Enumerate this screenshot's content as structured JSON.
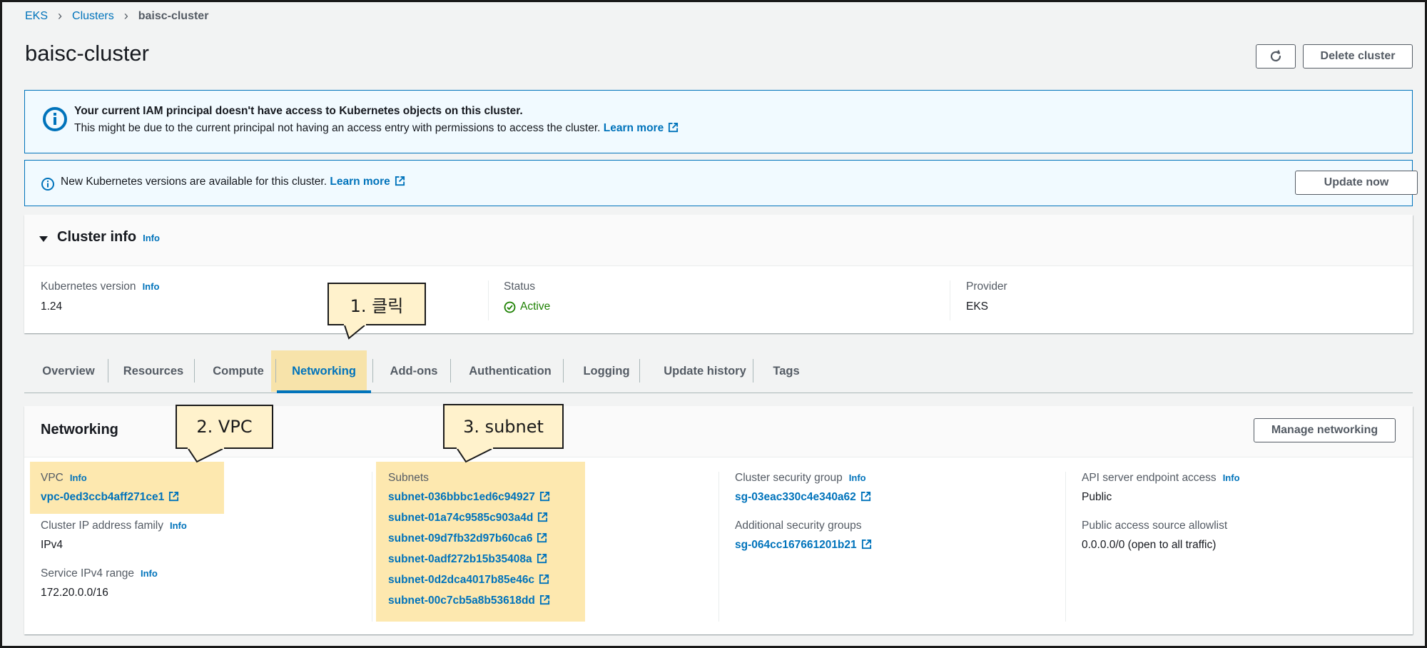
{
  "breadcrumb": {
    "items": [
      "EKS",
      "Clusters"
    ],
    "current": "baisc-cluster",
    "separator": ">"
  },
  "page": {
    "title": "baisc-cluster"
  },
  "header_buttons": {
    "refresh_icon": "refresh-icon",
    "delete_label": "Delete cluster"
  },
  "alerts": {
    "iam": {
      "title": "Your current IAM principal doesn't have access to Kubernetes objects on this cluster.",
      "body": "This might be due to the current principal not having an access entry with permissions to access the cluster.",
      "link": "Learn more"
    },
    "version": {
      "body": "New Kubernetes versions are available for this cluster.",
      "link": "Learn more",
      "button": "Update now"
    }
  },
  "cluster_info": {
    "title": "Cluster info",
    "info": "Info",
    "kubernetes_version": {
      "label": "Kubernetes version",
      "info": "Info",
      "value": "1.24"
    },
    "status": {
      "label": "Status",
      "value": "Active"
    },
    "provider": {
      "label": "Provider",
      "value": "EKS"
    }
  },
  "tabs": [
    "Overview",
    "Resources",
    "Compute",
    "Networking",
    "Add-ons",
    "Authentication",
    "Logging",
    "Update history",
    "Tags"
  ],
  "active_tab": "Networking",
  "networking": {
    "title": "Networking",
    "manage_button": "Manage networking",
    "vpc": {
      "label": "VPC",
      "info": "Info",
      "value": "vpc-0ed3ccb4aff271ce1"
    },
    "ip_family": {
      "label": "Cluster IP address family",
      "info": "Info",
      "value": "IPv4"
    },
    "service_range": {
      "label": "Service IPv4 range",
      "info": "Info",
      "value": "172.20.0.0/16"
    },
    "subnets": {
      "label": "Subnets",
      "values": [
        "subnet-036bbbc1ed6c94927",
        "subnet-01a74c9585c903a4d",
        "subnet-09d7fb32d97b60ca6",
        "subnet-0adf272b15b35408a",
        "subnet-0d2dca4017b85e46c",
        "subnet-00c7cb5a8b53618dd"
      ]
    },
    "cluster_sg": {
      "label": "Cluster security group",
      "info": "Info",
      "value": "sg-03eac330c4e340a62"
    },
    "additional_sg": {
      "label": "Additional security groups",
      "value": "sg-064cc167661201b21"
    },
    "endpoint_access": {
      "label": "API server endpoint access",
      "info": "Info",
      "value": "Public"
    },
    "allowlist": {
      "label": "Public access source allowlist",
      "value": "0.0.0.0/0 (open to all traffic)"
    }
  },
  "callouts": {
    "c1": "1. 클릭",
    "c2": "2. VPC",
    "c3": "3. subnet"
  },
  "colors": {
    "link": "#0073bb",
    "highlight": "#fcd66e",
    "callout_bg": "#fff2cc",
    "active": "#1d8102"
  }
}
